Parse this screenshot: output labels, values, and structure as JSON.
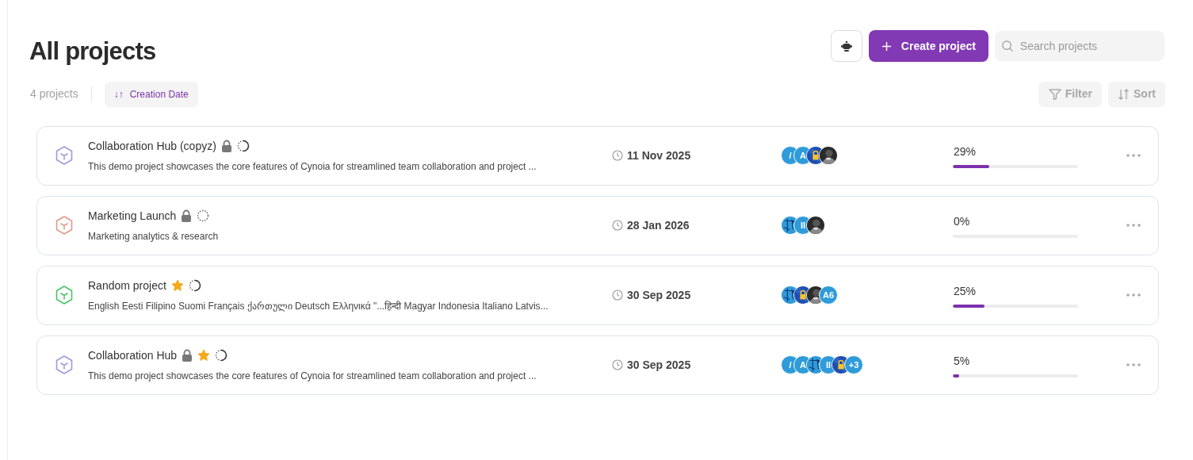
{
  "header": {
    "title": "All projects",
    "count": "4 projects",
    "sort_chip": {
      "icon_text": "↓↑",
      "label": "Creation Date"
    }
  },
  "actions": {
    "create_label": "Create project",
    "search_placeholder": "Search projects",
    "filter_label": "Filter",
    "sort_label": "Sort"
  },
  "projects": [
    {
      "name": "Collaboration Hub (copyz)",
      "description": "This demo project showcases the core features of Cynoia for streamlined team collaboration and project ...",
      "color": "#9b9be0",
      "locked": true,
      "starred": false,
      "started": true,
      "date": "11 Nov 2025",
      "progress": "29%",
      "level": 0.29,
      "members": [
        {
          "kind": "initials",
          "text": "/"
        },
        {
          "kind": "initials",
          "text": "A"
        },
        {
          "kind": "lock"
        },
        {
          "kind": "photo"
        }
      ]
    },
    {
      "name": "Marketing Launch",
      "description": "Marketing analytics & research",
      "color": "#e09a8a",
      "locked": true,
      "starred": false,
      "started": false,
      "date": "28 Jan 2026",
      "progress": "0%",
      "level": 0,
      "members": [
        {
          "kind": "pattern"
        },
        {
          "kind": "initials",
          "text": "II"
        },
        {
          "kind": "photo"
        }
      ]
    },
    {
      "name": "Random project",
      "description": "English Eesti Filipino Suomi Français ქართული Deutsch Ελληνικά \"...हिन्दी Magyar Indonesia Italiano Latvis...",
      "color": "#4cc46a",
      "locked": false,
      "starred": true,
      "started": true,
      "date": "30 Sep 2025",
      "progress": "25%",
      "level": 0.25,
      "members": [
        {
          "kind": "pattern"
        },
        {
          "kind": "lock"
        },
        {
          "kind": "photo"
        },
        {
          "kind": "initials",
          "text": "A6"
        }
      ]
    },
    {
      "name": "Collaboration Hub",
      "description": "This demo project showcases the core features of Cynoia for streamlined team collaboration and project ...",
      "color": "#9b9be0",
      "locked": true,
      "starred": true,
      "started": true,
      "date": "30 Sep 2025",
      "progress": "5%",
      "level": 0.05,
      "members": [
        {
          "kind": "initials",
          "text": "/"
        },
        {
          "kind": "initials",
          "text": "A"
        },
        {
          "kind": "pattern"
        },
        {
          "kind": "initials",
          "text": "II"
        },
        {
          "kind": "lock"
        },
        {
          "kind": "more",
          "text": "+3"
        }
      ]
    }
  ]
}
